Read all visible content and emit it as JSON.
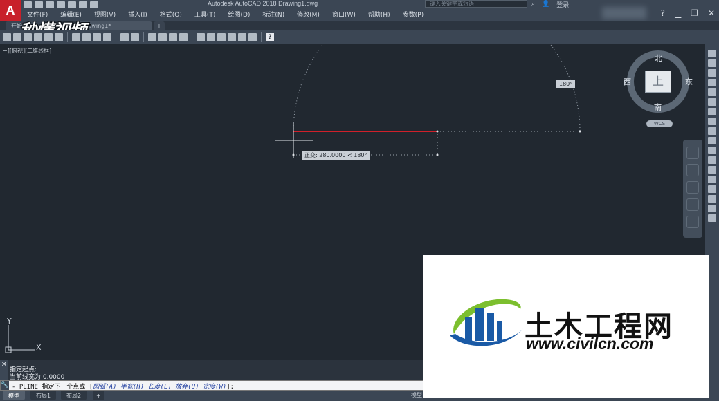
{
  "app": {
    "logo_letter": "A",
    "title": "Autodesk AutoCAD 2018    Drawing1.dwg",
    "search_placeholder": "键入关键字或短语",
    "login": "登录",
    "help": "?"
  },
  "menu": [
    "文件(F)",
    "编辑(E)",
    "视图(V)",
    "插入(I)",
    "格式(O)",
    "工具(T)",
    "绘图(D)",
    "标注(N)",
    "修改(M)",
    "窗口(W)",
    "帮助(H)",
    "参数(P)"
  ],
  "doc_tabs": {
    "start": "开始",
    "drawing": "Drawing1*",
    "add": "+"
  },
  "watermark_top": "秒懂视频",
  "viewport": {
    "label": "−][俯视][二维线框]"
  },
  "drawing": {
    "angle_tip": "180°",
    "polar_tip": "正交: 280.0000 < 180°"
  },
  "viewcube": {
    "north": "北",
    "south": "南",
    "east": "东",
    "west": "西",
    "top": "上",
    "wcs": "WCS"
  },
  "ucs": {
    "y": "Y",
    "x": "X"
  },
  "command": {
    "history_line1": "指定起点:",
    "history_line2": "当前线宽为 0.0000",
    "prompt_prefix": "- PLINE 指定下一个点或 [",
    "opt_arc": "圆弧(A)",
    "opt_halfwidth": "半宽(H)",
    "opt_length": "长度(L)",
    "opt_undo": "放弃(U)",
    "opt_width": "宽度(W)",
    "prompt_suffix": "]:"
  },
  "layout_tabs": {
    "model": "模型",
    "layout1": "布局1",
    "layout2": "布局2",
    "add": "+"
  },
  "status": {
    "model": "模型"
  },
  "watermark_logo": {
    "name": "土木工程网",
    "url": "www.civilcn.com",
    "brand_blue": "#1a5aa6",
    "brand_green": "#7cbf2e"
  },
  "colors": {
    "canvas": "#212830",
    "line": "#d0202a"
  }
}
